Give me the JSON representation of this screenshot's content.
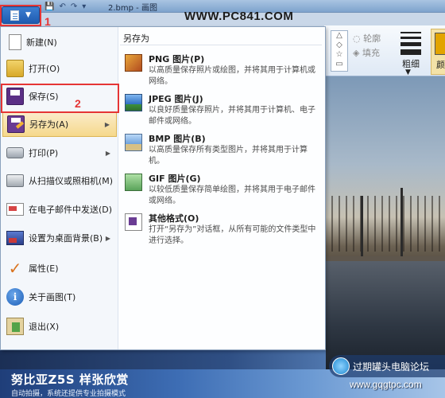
{
  "window": {
    "title": "2.bmp - 画图",
    "quick_access": [
      "💾",
      "↶",
      "↷",
      "▾"
    ]
  },
  "watermark": "WWW.PC841.COM",
  "annotations": {
    "step1": "1",
    "step2": "2"
  },
  "ribbon": {
    "outline_label": "轮廓",
    "fill_label": "填充",
    "thickness_label": "粗细",
    "color_label": "颜色"
  },
  "menu": {
    "items": [
      {
        "label": "新建(N)",
        "icon": "new-file-icon"
      },
      {
        "label": "打开(O)",
        "icon": "open-folder-icon"
      },
      {
        "label": "保存(S)",
        "icon": "save-disk-icon"
      },
      {
        "label": "另存为(A)",
        "icon": "save-as-icon",
        "has_submenu": true
      },
      {
        "label": "打印(P)",
        "icon": "printer-icon",
        "has_submenu": true
      },
      {
        "label": "从扫描仪或照相机(M)",
        "icon": "scanner-icon"
      },
      {
        "label": "在电子邮件中发送(D)",
        "icon": "email-icon"
      },
      {
        "label": "设置为桌面背景(B)",
        "icon": "desktop-icon",
        "has_submenu": true
      },
      {
        "label": "属性(E)",
        "icon": "properties-check-icon"
      },
      {
        "label": "关于画图(T)",
        "icon": "info-icon"
      },
      {
        "label": "退出(X)",
        "icon": "exit-icon"
      }
    ],
    "submenu_arrow": "▶"
  },
  "save_as_submenu": {
    "title": "另存为",
    "items": [
      {
        "title": "PNG 图片(P)",
        "desc": "以高质量保存照片或绘图，并将其用于计算机或网络。",
        "icon": "png-image-icon"
      },
      {
        "title": "JPEG 图片(J)",
        "desc": "以良好质量保存照片，并将其用于计算机、电子邮件或网络。",
        "icon": "jpeg-image-icon"
      },
      {
        "title": "BMP 图片(B)",
        "desc": "以高质量保存所有类型图片，并将其用于计算机。",
        "icon": "bmp-image-icon"
      },
      {
        "title": "GIF 图片(G)",
        "desc": "以较低质量保存简单绘图，并将其用于电子邮件或网络。",
        "icon": "gif-image-icon"
      },
      {
        "title": "其他格式(O)",
        "desc": "打开“另存为”对话框，从所有可能的文件类型中进行选择。",
        "icon": "other-formats-icon"
      }
    ]
  },
  "banner": {
    "title": "努比亚Z5S 样张欣赏",
    "subtitle": "自动拍摄，系统还提供专业拍摄模式"
  },
  "forum": {
    "name": "过期罐头电脑论坛",
    "url": "www.gqgtpc.com"
  },
  "colors": {
    "highlight_red": "#e53535",
    "active_item_bg": "#f5d88b",
    "app_button_blue": "#1f5bb0"
  }
}
